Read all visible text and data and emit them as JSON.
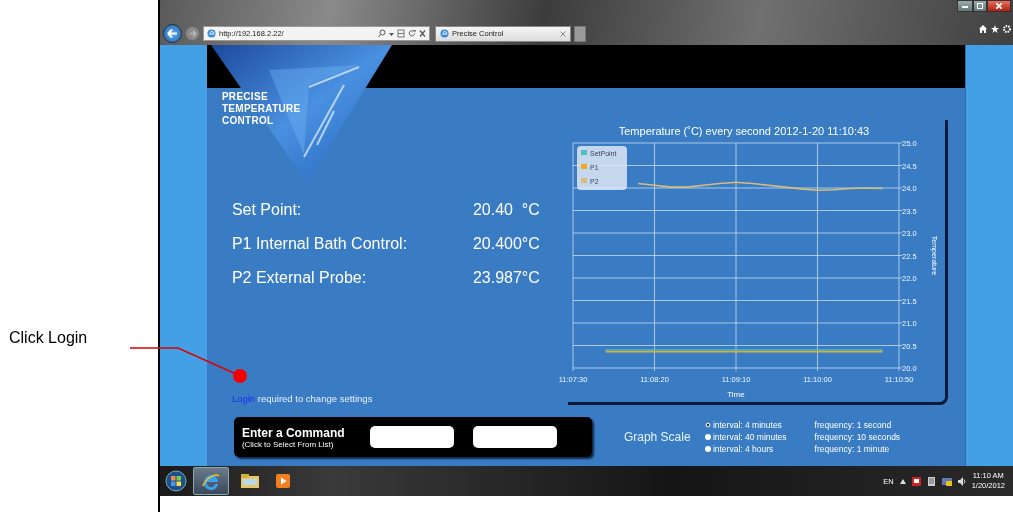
{
  "browser": {
    "address": "http://192.168.2.22/",
    "tab_title": "Precise Control"
  },
  "logo": {
    "lines": [
      "PRECISE",
      "TEMPERATURE",
      "CONTROL"
    ]
  },
  "readings": [
    {
      "label": "Set Point:",
      "value": "20.40  °C"
    },
    {
      "label": "P1 Internal Bath Control:",
      "value": "20.400°C"
    },
    {
      "label": "P2 External Probe:",
      "value": "23.987°C"
    }
  ],
  "login_notice": {
    "link": "Login",
    "text": " required to change settings"
  },
  "chart": {
    "chart_data": {
      "type": "line",
      "title": "Temperature (˚C) every second 2012-1-20 11:10:43",
      "xlabel": "Time",
      "ylabel": "Temperature",
      "categories": [
        "11:07:30",
        null,
        null,
        null,
        null,
        "11:08:20",
        null,
        null,
        null,
        null,
        "11:09:10",
        null,
        null,
        null,
        null,
        "11:10:00",
        null,
        null,
        null,
        null,
        "11:10:50"
      ],
      "series": [
        {
          "name": "SetPoint",
          "color": "#4fc0c8",
          "values": [
            null,
            null,
            20.4,
            20.4,
            20.4,
            20.4,
            20.4,
            20.4,
            20.4,
            20.4,
            20.4,
            20.4,
            20.4,
            20.4,
            20.4,
            20.4,
            20.4,
            20.4,
            20.4,
            20.4,
            null
          ]
        },
        {
          "name": "P1",
          "color": "#f0a81c",
          "values": [
            null,
            null,
            20.36,
            20.36,
            20.36,
            20.36,
            20.36,
            20.36,
            20.36,
            20.36,
            20.36,
            20.36,
            20.36,
            20.36,
            20.36,
            20.36,
            20.36,
            20.36,
            20.36,
            20.36,
            null
          ]
        },
        {
          "name": "P2",
          "color": "#d8bc7c",
          "values": [
            null,
            null,
            null,
            null,
            24.1,
            24.06,
            24.02,
            24.02,
            24.06,
            24.1,
            24.13,
            24.1,
            24.06,
            24.02,
            23.98,
            23.95,
            23.96,
            23.99,
            24.0,
            23.99,
            null
          ]
        }
      ],
      "ylim": [
        20,
        25
      ],
      "grid": true,
      "legend": true,
      "yticks": [
        {
          "value": 20,
          "label": "20.0"
        },
        {
          "value": 20.5,
          "label": "20.5"
        },
        {
          "value": 21,
          "label": "21.0"
        },
        {
          "value": 21.5,
          "label": "21.5"
        },
        {
          "value": 22,
          "label": "22.0"
        },
        {
          "value": 22.5,
          "label": "22.5"
        },
        {
          "value": 23,
          "label": "23.0"
        },
        {
          "value": 23.5,
          "label": "23.5"
        },
        {
          "value": 24,
          "label": "24.0"
        },
        {
          "value": 24.5,
          "label": "24.5"
        },
        {
          "value": 25,
          "label": "25.0"
        }
      ]
    }
  },
  "command_panel": {
    "title": "Enter a Command",
    "subtitle": "(Click to Select From List)"
  },
  "graph_scale": {
    "label": "Graph Scale",
    "options": [
      {
        "interval": "interval: 4 minutes",
        "frequency": "frequency: 1 second",
        "selected": true
      },
      {
        "interval": "interval: 40 minutes",
        "frequency": "frequency: 10 seconds",
        "selected": false
      },
      {
        "interval": "interval: 4 hours",
        "frequency": "frequency: 1 minute",
        "selected": false
      }
    ]
  },
  "taskbar": {
    "language": "EN",
    "time": "11:10 AM",
    "date": "1/20/2012"
  },
  "annotation": {
    "text": "Click Login"
  }
}
